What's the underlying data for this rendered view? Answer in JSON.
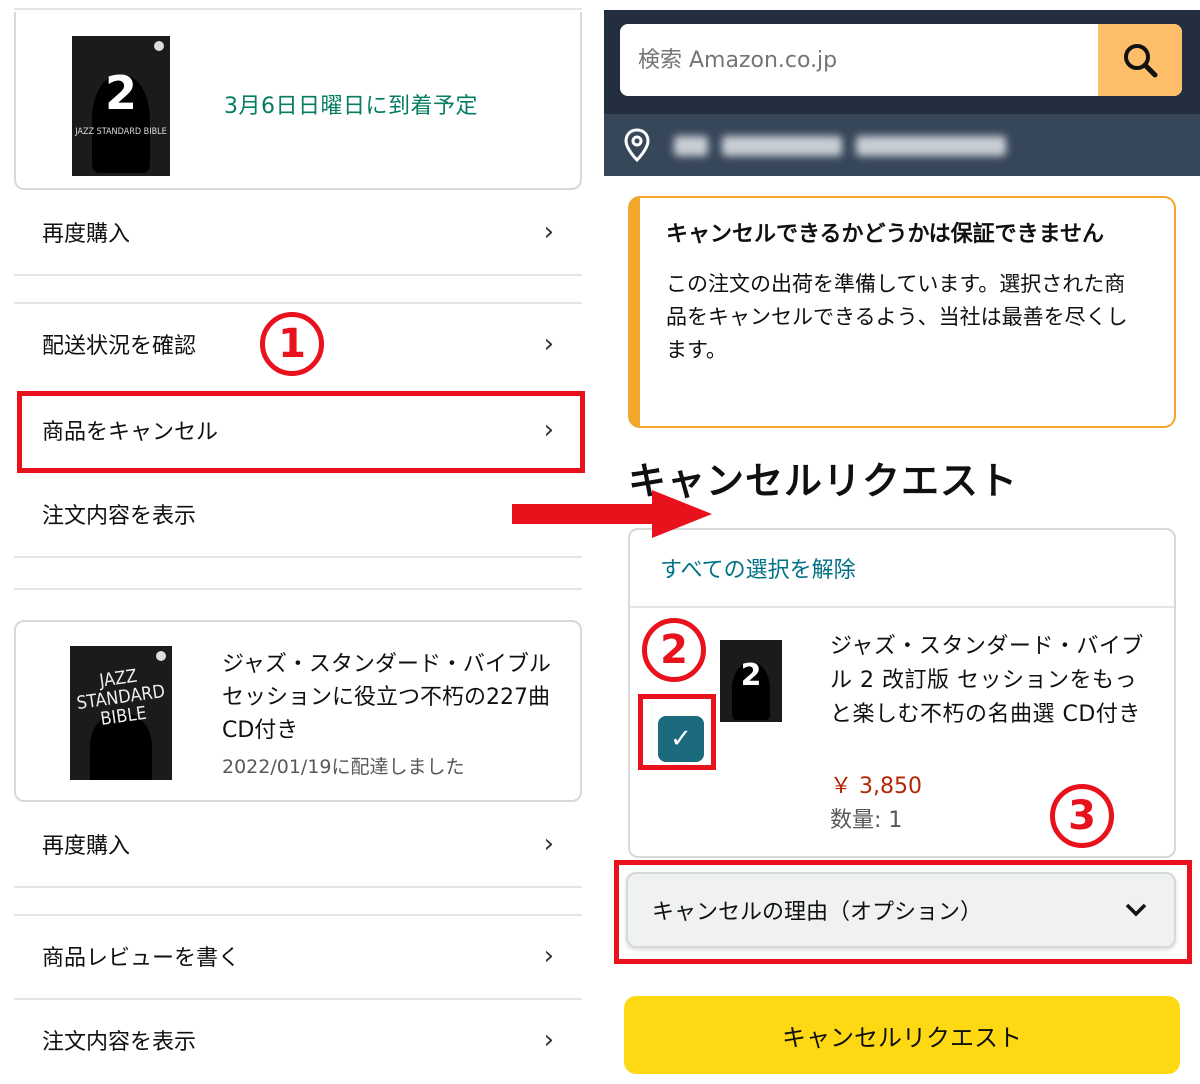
{
  "left": {
    "order1": {
      "arrival": "3月6日日曜日に到着予定",
      "cover_number": "2",
      "cover_text": "JAZZ STANDARD BIBLE"
    },
    "rows1": [
      {
        "label": "再度購入"
      },
      {
        "label": "配送状況を確認"
      },
      {
        "label": "商品をキャンセル"
      },
      {
        "label": "注文内容を表示"
      }
    ],
    "order2": {
      "title": "ジャズ・スタンダード・バイブル セッションに役立つ不朽の227曲 CD付き",
      "delivered": "2022/01/19に配達しました",
      "cover_text": "JAZZ STANDARD BIBLE"
    },
    "rows2": [
      {
        "label": "再度購入"
      },
      {
        "label": "商品レビューを書く"
      },
      {
        "label": "注文内容を表示"
      }
    ],
    "chevron": "›"
  },
  "right": {
    "search": {
      "placeholder": "検索 Amazon.co.jp"
    },
    "notice": {
      "title": "キャンセルできるかどうかは保証できません",
      "body": "この注文の出荷を準備しています。選択された商品をキャンセルできるよう、当社は最善を尽くします。"
    },
    "section_title": "キャンセルリクエスト",
    "deselect_all": "すべての選択を解除",
    "item": {
      "title": "ジャズ・スタンダード・バイブル 2 改訂版 セッションをもっと楽しむ不朽の名曲選 CD付き",
      "price": "￥ 3,850",
      "quantity": "数量: 1",
      "checked": true,
      "cover_number": "2"
    },
    "reason_select": "キャンセルの理由（オプション）",
    "submit_button": "キャンセルリクエスト"
  },
  "annotations": {
    "step1": "1",
    "step2": "2",
    "step3": "3"
  },
  "colors": {
    "annotation_red": "#e8111c",
    "arrival_green": "#067d62",
    "link_teal": "#007185",
    "price_red": "#b12704",
    "header_navy": "#232f3e",
    "search_button": "#febd69",
    "cta_yellow": "#ffd814",
    "notice_orange": "#f0a72a"
  }
}
